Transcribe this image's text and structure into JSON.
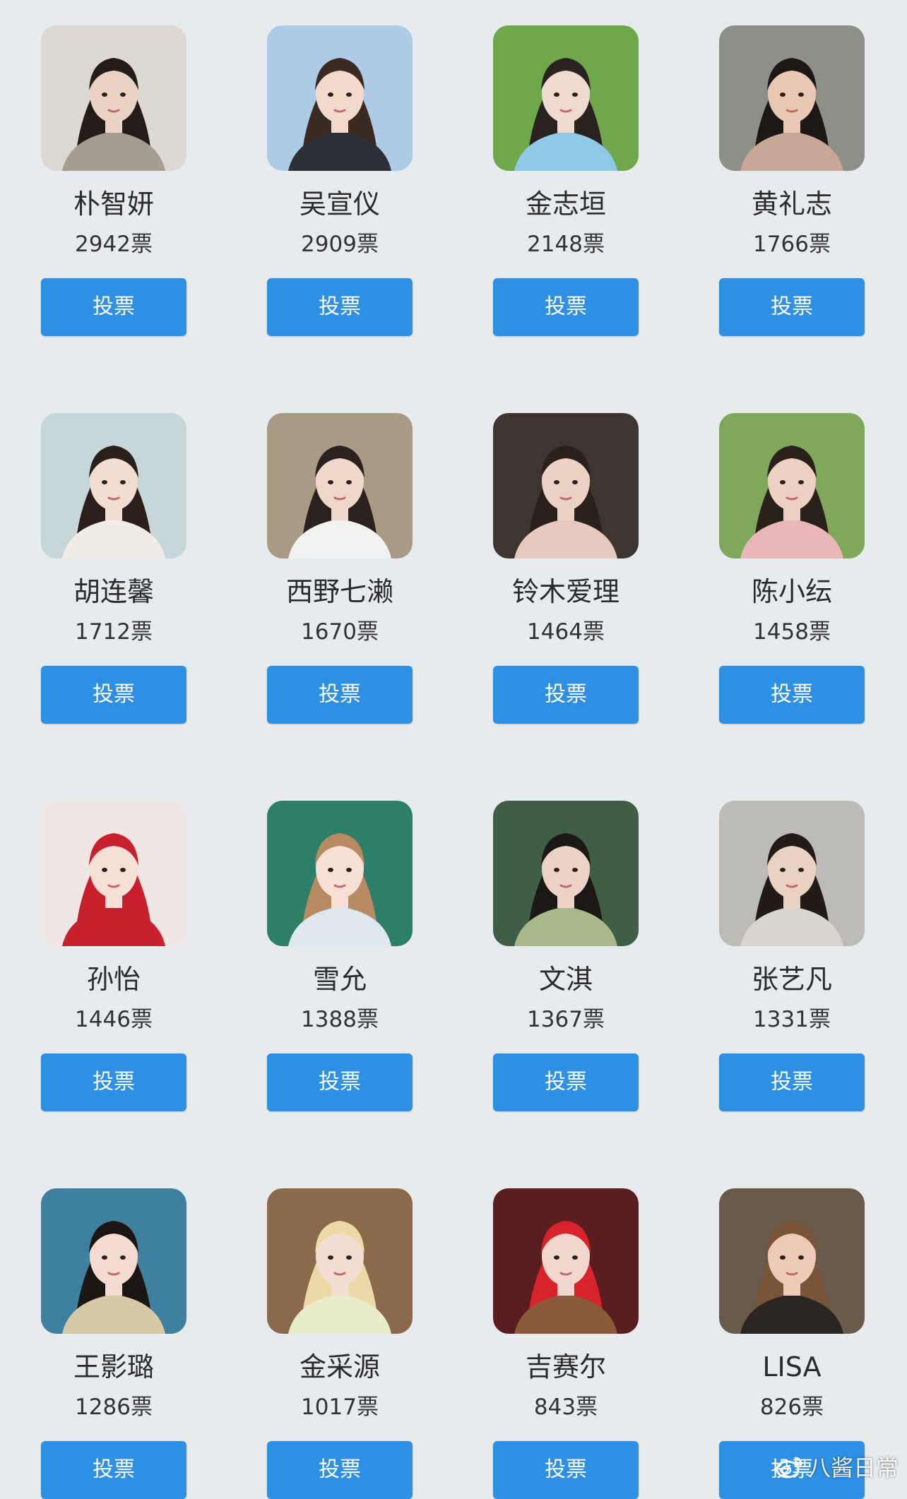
{
  "button_label": "投票",
  "colors": {
    "background": "#e8ebee",
    "button": "#2e90e4",
    "button_text": "#ffffff",
    "text": "#2b2b2b"
  },
  "candidates": [
    {
      "name": "朴智妍",
      "votes": "2942票",
      "bg": "#ddd9d2",
      "hair": "#241c18",
      "skin": "#ead3c4",
      "cloth": "#a39d92"
    },
    {
      "name": "吴宣仪",
      "votes": "2909票",
      "bg": "#aecbe6",
      "hair": "#3b2a22",
      "skin": "#f1d9cc",
      "cloth": "#2e3038"
    },
    {
      "name": "金志垣",
      "votes": "2148票",
      "bg": "#6fa84a",
      "hair": "#2a221e",
      "skin": "#f0dad0",
      "cloth": "#8fc9e6"
    },
    {
      "name": "黄礼志",
      "votes": "1766票",
      "bg": "#8e8f86",
      "hair": "#1d1816",
      "skin": "#e8c8b4",
      "cloth": "#c9a797"
    },
    {
      "name": "胡连馨",
      "votes": "1712票",
      "bg": "#c6d6d9",
      "hair": "#2a1f1a",
      "skin": "#f3dcd1",
      "cloth": "#f1ece6"
    },
    {
      "name": "西野七濑",
      "votes": "1670票",
      "bg": "#a89a84",
      "hair": "#2b2220",
      "skin": "#efd7c9",
      "cloth": "#f2f2f0"
    },
    {
      "name": "铃木爱理",
      "votes": "1464票",
      "bg": "#3e3530",
      "hair": "#2a201c",
      "skin": "#ecd2c4",
      "cloth": "#e8c9c0"
    },
    {
      "name": "陈小纭",
      "votes": "1458票",
      "bg": "#7fa85a",
      "hair": "#2b211b",
      "skin": "#ecd1c2",
      "cloth": "#e9b6b9"
    },
    {
      "name": "孙怡",
      "votes": "1446票",
      "bg": "#f0e6e4",
      "hair": "#c8202c",
      "skin": "#f5dfd6",
      "cloth": "#c8202c"
    },
    {
      "name": "雪允",
      "votes": "1388票",
      "bg": "#2e7f68",
      "hair": "#b88a62",
      "skin": "#f6e0d6",
      "cloth": "#dfe7ee"
    },
    {
      "name": "文淇",
      "votes": "1367票",
      "bg": "#3f5e45",
      "hair": "#1c1816",
      "skin": "#ecd3c5",
      "cloth": "#a9b98a"
    },
    {
      "name": "张艺凡",
      "votes": "1331票",
      "bg": "#bcbbb5",
      "hair": "#231b18",
      "skin": "#ead2c3",
      "cloth": "#d9d4cd"
    },
    {
      "name": "王影璐",
      "votes": "1286票",
      "bg": "#3f7fa0",
      "hair": "#1b1513",
      "skin": "#f3dbd0",
      "cloth": "#d6c9a6"
    },
    {
      "name": "金采源",
      "votes": "1017票",
      "bg": "#8a6a4a",
      "hair": "#ecd9a8",
      "skin": "#f3ddd2",
      "cloth": "#e9ecc9"
    },
    {
      "name": "吉赛尔",
      "votes": "843票",
      "bg": "#5a1d20",
      "hair": "#d8222c",
      "skin": "#f1d7cc",
      "cloth": "#8a5a3a"
    },
    {
      "name": "LISA",
      "votes": "826票",
      "bg": "#6a5a4a",
      "hair": "#7a5436",
      "skin": "#eccab7",
      "cloth": "#2a2422"
    }
  ],
  "watermark": {
    "text": "八酱日常",
    "icon": "weibo-logo-icon"
  }
}
